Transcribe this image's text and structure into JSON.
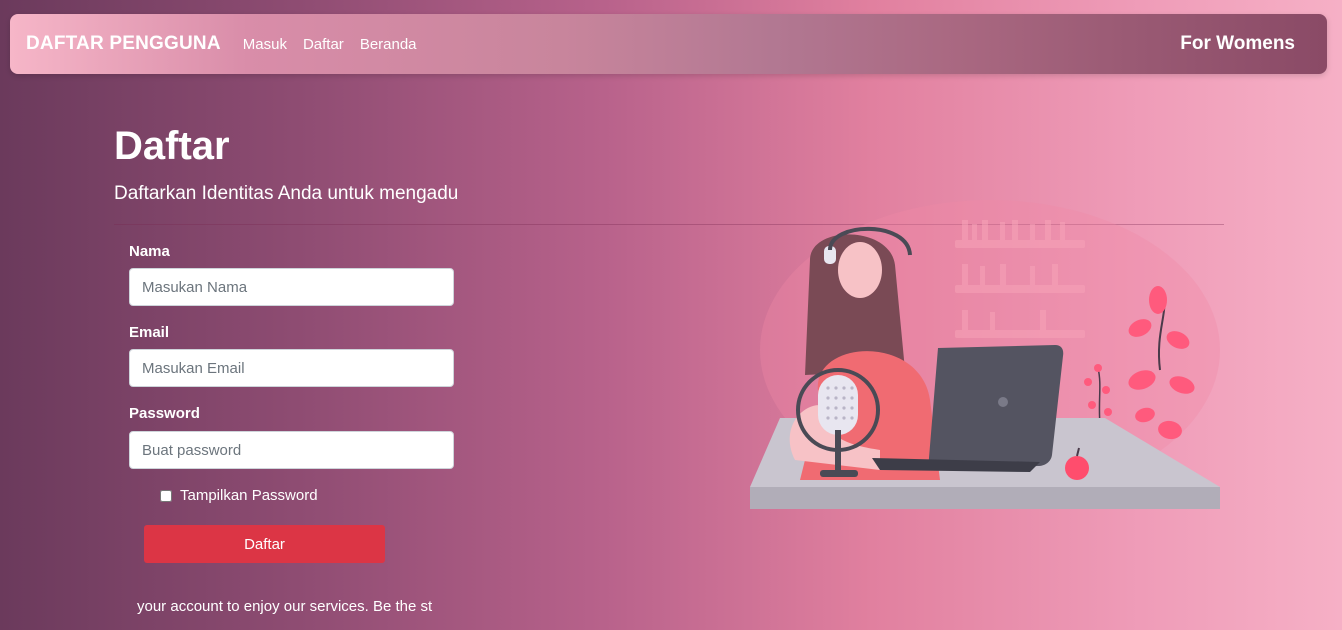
{
  "navbar": {
    "brand": "DAFTAR PENGGUNA",
    "links": [
      "Masuk",
      "Daftar",
      "Beranda"
    ],
    "right_text": "For Womens"
  },
  "header": {
    "title": "Daftar",
    "subtitle": "Daftarkan Identitas Anda untuk mengadu"
  },
  "form": {
    "name_label": "Nama",
    "name_placeholder": "Masukan Nama",
    "email_label": "Email",
    "email_placeholder": "Masukan Email",
    "password_label": "Password",
    "password_placeholder": "Buat password",
    "show_password_label": "Tampilkan Password",
    "show_password_checked": false,
    "submit_label": "Daftar"
  },
  "marquee": {
    "text": "your account to enjoy our services. Be the st"
  },
  "illustration": {
    "icon": "woman-podcast-laptop-illustration"
  },
  "colors": {
    "submit_button": "#dc3545",
    "background_start": "#6b3a5c",
    "background_end": "#f6b0c6"
  }
}
